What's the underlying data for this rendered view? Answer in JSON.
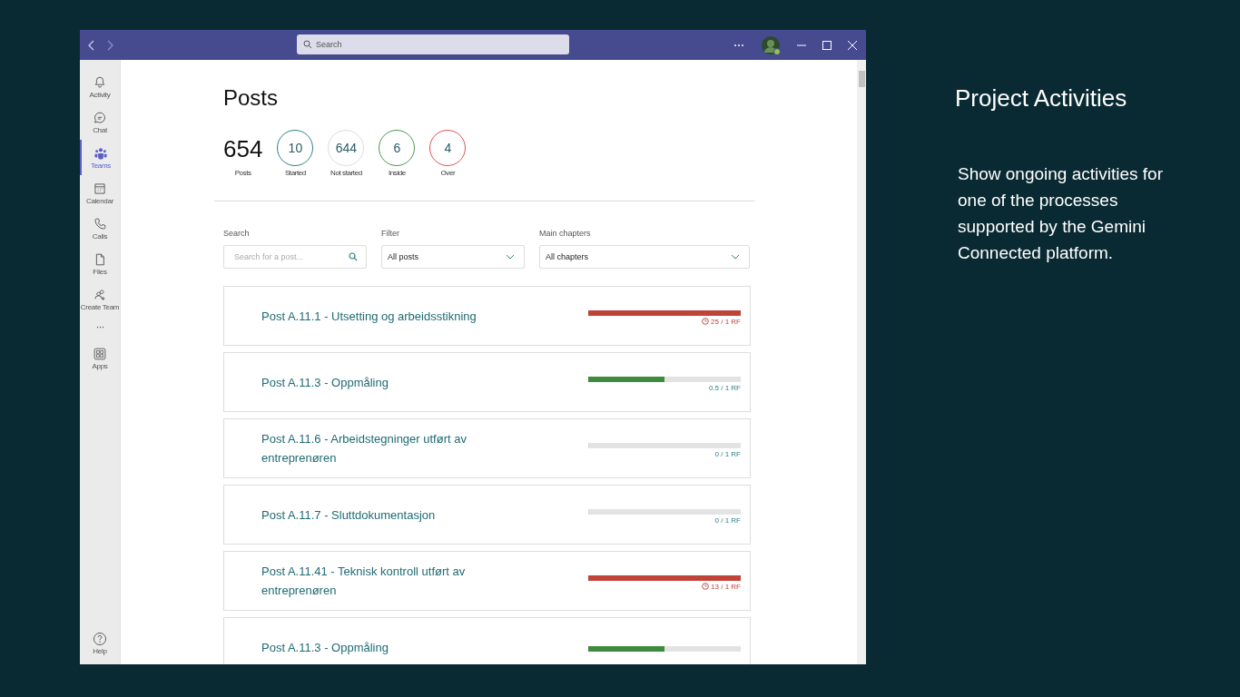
{
  "titlebar": {
    "search_placeholder": "Search"
  },
  "sidebar": {
    "items": [
      {
        "label": "Activity",
        "selected": false
      },
      {
        "label": "Chat",
        "selected": false
      },
      {
        "label": "Teams",
        "selected": true
      },
      {
        "label": "Calendar",
        "selected": false
      },
      {
        "label": "Calls",
        "selected": false
      },
      {
        "label": "Files",
        "selected": false
      },
      {
        "label": "Create Team",
        "selected": false
      }
    ],
    "more": "···",
    "apps": {
      "label": "Apps"
    },
    "help": {
      "label": "Help"
    }
  },
  "page": {
    "title": "Posts",
    "total": {
      "value": "654",
      "label": "Posts"
    },
    "stats": [
      {
        "value": "10",
        "label": "Started",
        "color": "#2f7f86"
      },
      {
        "value": "644",
        "label": "Not started",
        "color": "#dddddd"
      },
      {
        "value": "6",
        "label": "Inside",
        "color": "#4a9a4a"
      },
      {
        "value": "4",
        "label": "Over",
        "color": "#d9534f"
      }
    ],
    "filters": {
      "search": {
        "label": "Search",
        "placeholder": "Search for a post..."
      },
      "filter": {
        "label": "Filter",
        "value": "All posts"
      },
      "chapters": {
        "label": "Main chapters",
        "value": "All chapters"
      }
    },
    "posts": [
      {
        "title": "Post A.11.1 - Utsetting og arbeidsstikning",
        "level": 1,
        "color": "#c0433a",
        "reading": "25 / 1 RF",
        "over": true
      },
      {
        "title": "Post A.11.3 - Oppmåling",
        "level": 0.5,
        "color": "#3e8a3e",
        "reading": "0.5 / 1 RF",
        "over": false
      },
      {
        "title": "Post A.11.6 - Arbeidstegninger utført av entreprenøren",
        "level": 0,
        "reading": "0 / 1 RF",
        "over": false
      },
      {
        "title": "Post A.11.7 - Sluttdokumentasjon",
        "level": 0,
        "reading": "0 / 1 RF",
        "over": false
      },
      {
        "title": "Post A.11.41 - Teknisk kontroll utført av entreprenøren",
        "level": 1,
        "color": "#c0433a",
        "reading": "13 / 1 RF",
        "over": true
      },
      {
        "title": "Post A.11.3 - Oppmåling",
        "level": 0.5,
        "color": "#3e8a3e"
      }
    ]
  },
  "aside": {
    "title": "Project Activities",
    "text": "Show ongoing activities for one of the processes supported by the Gemini Connected platform."
  }
}
